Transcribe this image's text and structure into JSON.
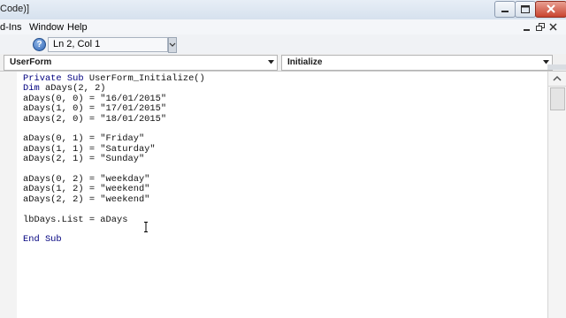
{
  "window": {
    "title": "Code)]",
    "faded_title": "",
    "minimize_icon": "minimize-icon",
    "maximize_icon": "maximize-icon",
    "close_icon": "close-icon"
  },
  "menu": {
    "items": [
      "d-Ins",
      "Window",
      "Help"
    ]
  },
  "toolbar": {
    "help_icon": "help-icon",
    "help_glyph": "?",
    "status": "Ln 2, Col 1"
  },
  "combos": {
    "object": "UserForm",
    "procedure": "Initialize"
  },
  "code": {
    "lines": [
      {
        "kw": "Private Sub",
        "text": " UserForm_Initialize()"
      },
      {
        "kw": "Dim",
        "text": " aDays(2, 2)"
      },
      {
        "kw": "",
        "text": "aDays(0, 0) = \"16/01/2015\""
      },
      {
        "kw": "",
        "text": "aDays(1, 0) = \"17/01/2015\""
      },
      {
        "kw": "",
        "text": "aDays(2, 0) = \"18/01/2015\""
      },
      {
        "kw": "",
        "text": ""
      },
      {
        "kw": "",
        "text": "aDays(0, 1) = \"Friday\""
      },
      {
        "kw": "",
        "text": "aDays(1, 1) = \"Saturday\""
      },
      {
        "kw": "",
        "text": "aDays(2, 1) = \"Sunday\""
      },
      {
        "kw": "",
        "text": ""
      },
      {
        "kw": "",
        "text": "aDays(0, 2) = \"weekday\""
      },
      {
        "kw": "",
        "text": "aDays(1, 2) = \"weekend\""
      },
      {
        "kw": "",
        "text": "aDays(2, 2) = \"weekend\""
      },
      {
        "kw": "",
        "text": ""
      },
      {
        "kw": "",
        "text": "lbDays.List = aDays"
      },
      {
        "kw": "",
        "text": ""
      },
      {
        "kw": "End Sub",
        "text": ""
      }
    ]
  },
  "colors": {
    "keyword": "#00007f",
    "code_text": "#111111",
    "close_button": "#c9442f"
  }
}
